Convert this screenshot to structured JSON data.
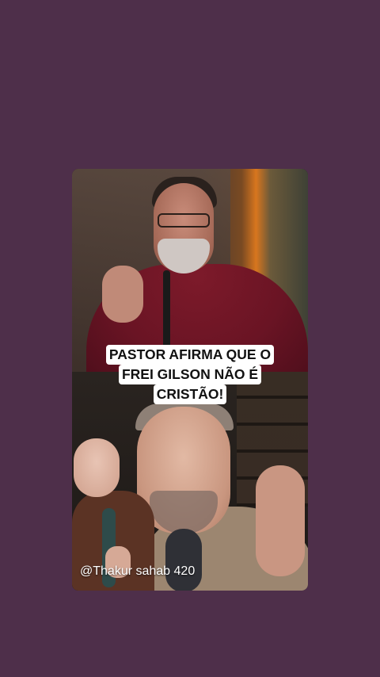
{
  "story": {
    "caption_lines": [
      "PASTOR AFIRMA QUE O",
      "FREI GILSON NÃO É",
      "CRISTÃO!"
    ],
    "handle": "@Thakur sahab 420"
  },
  "colors": {
    "page_background": "#4e2f4a",
    "caption_background": "#ffffff",
    "caption_text": "#111111",
    "handle_text": "#ffffff"
  }
}
